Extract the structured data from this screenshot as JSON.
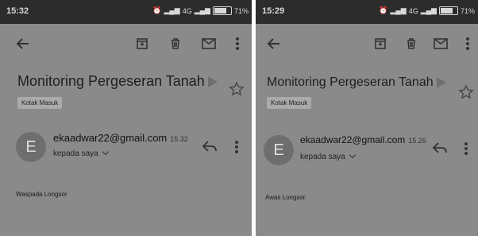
{
  "screens": [
    {
      "status_bar": {
        "time": "15:32",
        "network": "4G",
        "battery": "71%",
        "battery_level": 0.71
      },
      "toolbar": {
        "back": "arrow-back-icon",
        "archive": "archive-icon",
        "delete": "trash-icon",
        "mark_unread": "mail-icon",
        "more": "more-vert-icon"
      },
      "email": {
        "subject": "Monitoring Pergeseran Tanah",
        "label": "Kotak Masuk",
        "sender_initial": "E",
        "sender": "ekaadwar22@gmail.com",
        "time": "15.32",
        "recipient": "kepada saya",
        "body": "Waspada Longsor"
      }
    },
    {
      "status_bar": {
        "time": "15:29",
        "network": "4G",
        "battery": "71%",
        "battery_level": 0.71
      },
      "toolbar": {
        "back": "arrow-back-icon",
        "archive": "archive-icon",
        "delete": "trash-icon",
        "mark_unread": "mail-icon",
        "more": "more-vert-icon"
      },
      "email": {
        "subject": "Monitoring Pergeseran Tanah",
        "label": "Kotak Masuk",
        "sender_initial": "E",
        "sender": "ekaadwar22@gmail.com",
        "time": "15.26",
        "recipient": "kepada saya",
        "body": "Awas Longsor"
      }
    }
  ]
}
